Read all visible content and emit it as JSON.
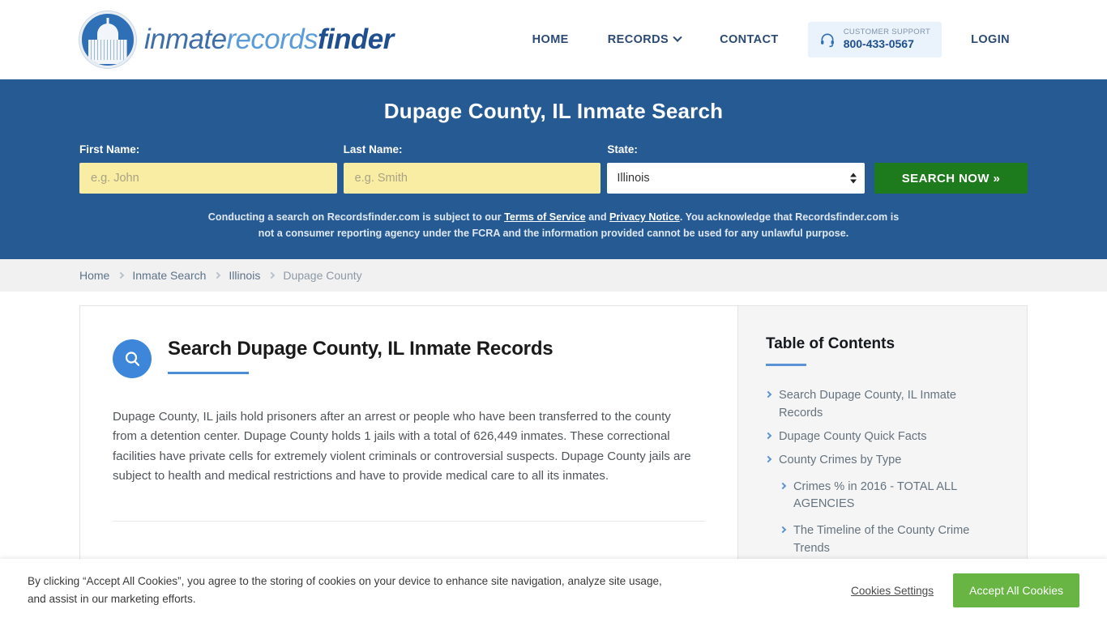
{
  "header": {
    "logo": {
      "part1": "inmate",
      "part2": "records",
      "part3": "finder",
      "seal_icon": "capitol-dome-seal"
    },
    "nav": [
      {
        "label": "HOME",
        "has_dropdown": false
      },
      {
        "label": "RECORDS",
        "has_dropdown": true
      },
      {
        "label": "CONTACT",
        "has_dropdown": false
      }
    ],
    "support": {
      "icon": "headset-icon",
      "caption": "CUSTOMER SUPPORT",
      "phone": "800-433-0567"
    },
    "login_label": "LOGIN"
  },
  "hero": {
    "title": "Dupage County, IL Inmate Search",
    "bg_color": "#265a92",
    "fields": {
      "first_name": {
        "label": "First Name:",
        "placeholder": "e.g. John",
        "value": ""
      },
      "last_name": {
        "label": "Last Name:",
        "placeholder": "e.g. Smith",
        "value": ""
      },
      "state": {
        "label": "State:",
        "value": "Illinois"
      }
    },
    "search_button": "SEARCH NOW »",
    "search_button_color": "#1d7a1d",
    "disclaimer": {
      "pre": "Conducting a search on Recordsfinder.com is subject to our ",
      "link1": "Terms of Service",
      "mid": " and ",
      "link2": "Privacy Notice",
      "post": ". You acknowledge that Recordsfinder.com is not a consumer reporting agency under the FCRA and the information provided cannot be used for any unlawful purpose."
    }
  },
  "breadcrumb": [
    {
      "label": "Home",
      "current": false
    },
    {
      "label": "Inmate Search",
      "current": false
    },
    {
      "label": "Illinois",
      "current": false
    },
    {
      "label": "Dupage County",
      "current": true
    }
  ],
  "content": {
    "icon": "search-circle-icon",
    "heading": "Search Dupage County, IL Inmate Records",
    "paragraph": "Dupage County, IL jails hold prisoners after an arrest or people who have been transferred to the county from a detention center. Dupage County holds 1 jails with a total of 626,449 inmates. These correctional facilities have private cells for extremely violent criminals or controversial suspects. Dupage County jails are subject to health and medical restrictions and have to provide medical care to all its inmates."
  },
  "toc": {
    "title": "Table of Contents",
    "items": [
      {
        "label": "Search Dupage County, IL Inmate Records",
        "sub": false
      },
      {
        "label": "Dupage County Quick Facts",
        "sub": false
      },
      {
        "label": "County Crimes by Type",
        "sub": false
      },
      {
        "label": "Crimes % in 2016 - TOTAL ALL AGENCIES",
        "sub": true
      },
      {
        "label": "The Timeline of the County Crime Trends",
        "sub": true
      }
    ]
  },
  "cookie": {
    "text": "By clicking “Accept All Cookies”, you agree to the storing of cookies on your device to enhance site navigation, analyze site usage, and assist in our marketing efforts.",
    "settings_label": "Cookies Settings",
    "accept_label": "Accept All Cookies",
    "accept_color": "#68b544"
  }
}
